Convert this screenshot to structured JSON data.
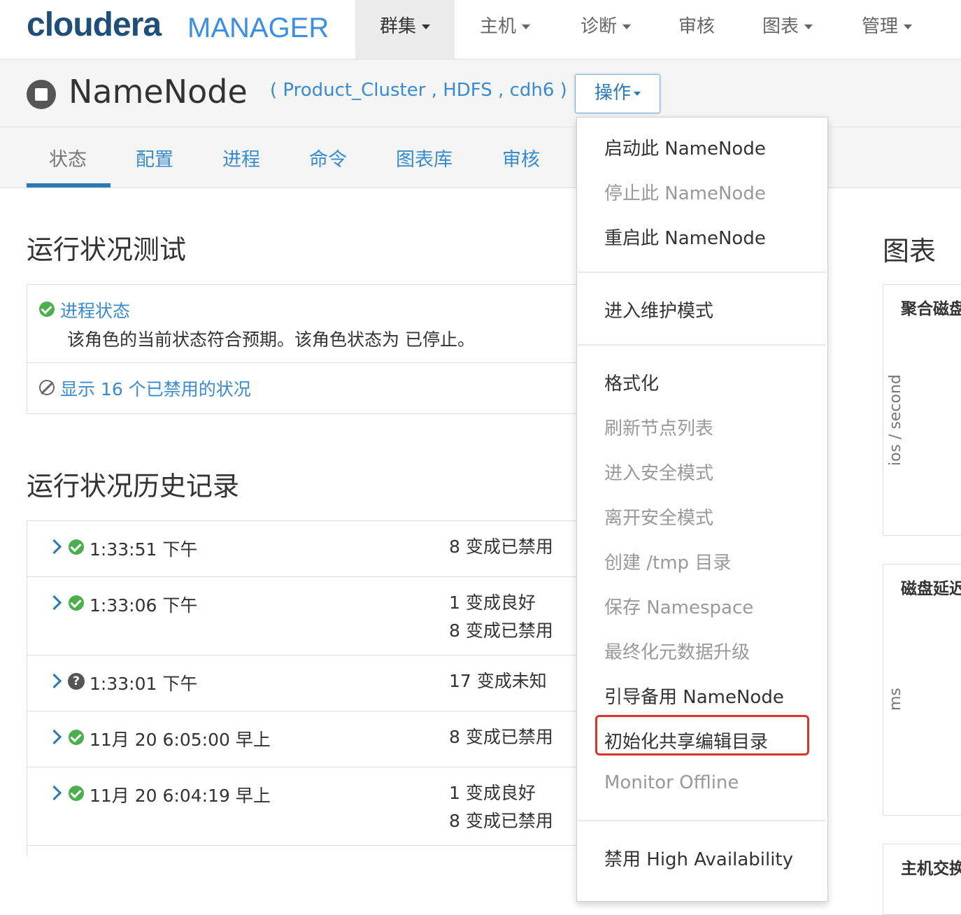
{
  "brand": {
    "name": "cloudera",
    "product": "MANAGER"
  },
  "topnav": {
    "items": [
      {
        "label": "群集",
        "dropdown": true,
        "active": true
      },
      {
        "label": "主机",
        "dropdown": true
      },
      {
        "label": "诊断",
        "dropdown": true
      },
      {
        "label": "审核",
        "dropdown": false
      },
      {
        "label": "图表",
        "dropdown": true
      },
      {
        "label": "管理",
        "dropdown": true
      }
    ]
  },
  "header": {
    "role_title": "NameNode",
    "context": "( Product_Cluster , HDFS , cdh6 )",
    "actions_label": "操作"
  },
  "tabs": [
    "状态",
    "配置",
    "进程",
    "命令",
    "图表库",
    "审核"
  ],
  "health": {
    "title": "运行状况测试",
    "test_name": "进程状态",
    "test_desc": "该角色的当前状态符合预期。该角色状态为 已停止。",
    "disabled_link": "显示 16 个已禁用的状况"
  },
  "history": {
    "title": "运行状况历史记录",
    "rows": [
      {
        "time": "1:33:51 下午",
        "status": "ok",
        "changes": [
          "8 变成已禁用"
        ]
      },
      {
        "time": "1:33:06 下午",
        "status": "ok",
        "changes": [
          "1 变成良好",
          "8 变成已禁用"
        ]
      },
      {
        "time": "1:33:01 下午",
        "status": "unknown",
        "changes": [
          "17 变成未知"
        ]
      },
      {
        "time": "11月 20 6:05:00 早上",
        "status": "ok",
        "changes": [
          "8 变成已禁用"
        ]
      },
      {
        "time": "11月 20 6:04:19 早上",
        "status": "ok",
        "changes": [
          "1 变成良好",
          "8 变成已禁用"
        ]
      }
    ]
  },
  "charts": {
    "title": "图表",
    "cards": [
      {
        "title": "聚合磁盘",
        "ylabel": "ios / second"
      },
      {
        "title": "磁盘延迟",
        "ylabel": "ms"
      },
      {
        "title": "主机交换"
      }
    ]
  },
  "actions_menu": {
    "items": [
      {
        "label": "启动此 NameNode",
        "enabled": true
      },
      {
        "label": "停止此 NameNode",
        "enabled": false
      },
      {
        "label": "重启此 NameNode",
        "enabled": true
      },
      {
        "label": "进入维护模式",
        "enabled": true
      },
      {
        "label": "格式化",
        "enabled": true
      },
      {
        "label": "刷新节点列表",
        "enabled": false
      },
      {
        "label": "进入安全模式",
        "enabled": false
      },
      {
        "label": "离开安全模式",
        "enabled": false
      },
      {
        "label": "创建 /tmp 目录",
        "enabled": false
      },
      {
        "label": "保存 Namespace",
        "enabled": false
      },
      {
        "label": "最终化元数据升级",
        "enabled": false
      },
      {
        "label": "引导备用 NameNode",
        "enabled": true
      },
      {
        "label": "初始化共享编辑目录",
        "enabled": true,
        "highlighted": true
      },
      {
        "label": "Monitor Offline",
        "enabled": false
      },
      {
        "label": "禁用 High Availability",
        "enabled": true
      }
    ]
  },
  "colors": {
    "link": "#3a8bcd",
    "ok": "#4cae4c",
    "highlight": "#d9342b",
    "brand_dark": "#1f4e79",
    "brand_light": "#3c8ede"
  }
}
